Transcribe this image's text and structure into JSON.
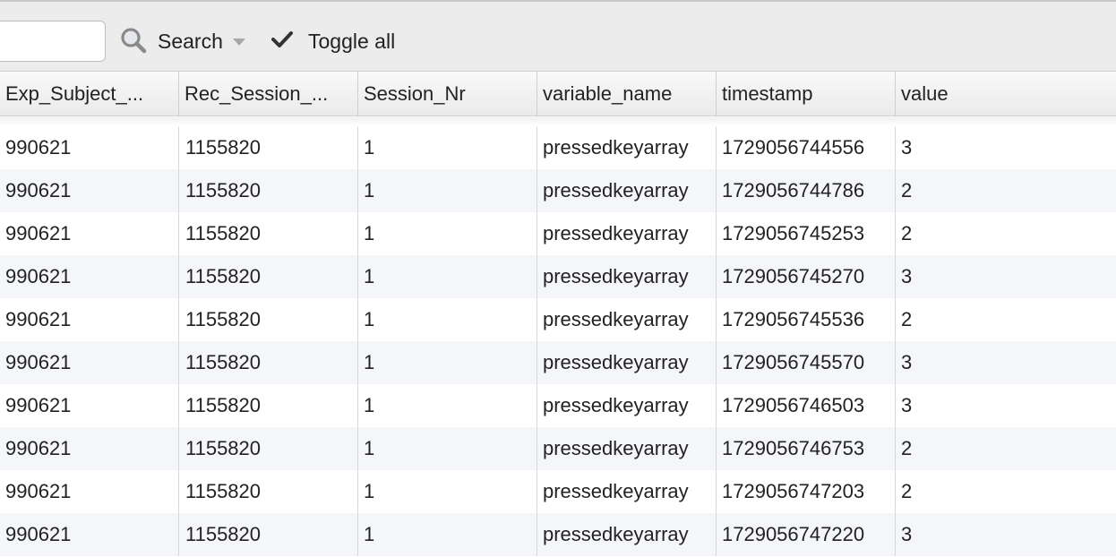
{
  "toolbar": {
    "search_value": "",
    "search_label": "Search",
    "toggle_label": "Toggle all"
  },
  "columns": [
    "Exp_Subject_...",
    "Rec_Session_...",
    "Session_Nr",
    "variable_name",
    "timestamp",
    "value"
  ],
  "rows": [
    [
      "990621",
      "1155820",
      "1",
      "pressedkeyarray",
      "1729056744556",
      "3"
    ],
    [
      "990621",
      "1155820",
      "1",
      "pressedkeyarray",
      "1729056744786",
      "2"
    ],
    [
      "990621",
      "1155820",
      "1",
      "pressedkeyarray",
      "1729056745253",
      "2"
    ],
    [
      "990621",
      "1155820",
      "1",
      "pressedkeyarray",
      "1729056745270",
      "3"
    ],
    [
      "990621",
      "1155820",
      "1",
      "pressedkeyarray",
      "1729056745536",
      "2"
    ],
    [
      "990621",
      "1155820",
      "1",
      "pressedkeyarray",
      "1729056745570",
      "3"
    ],
    [
      "990621",
      "1155820",
      "1",
      "pressedkeyarray",
      "1729056746503",
      "3"
    ],
    [
      "990621",
      "1155820",
      "1",
      "pressedkeyarray",
      "1729056746753",
      "2"
    ],
    [
      "990621",
      "1155820",
      "1",
      "pressedkeyarray",
      "1729056747203",
      "2"
    ],
    [
      "990621",
      "1155820",
      "1",
      "pressedkeyarray",
      "1729056747220",
      "3"
    ]
  ],
  "icons": {
    "search": "magnifier-icon",
    "dropdown": "caret-down-icon",
    "toggle": "checkmark-icon"
  }
}
